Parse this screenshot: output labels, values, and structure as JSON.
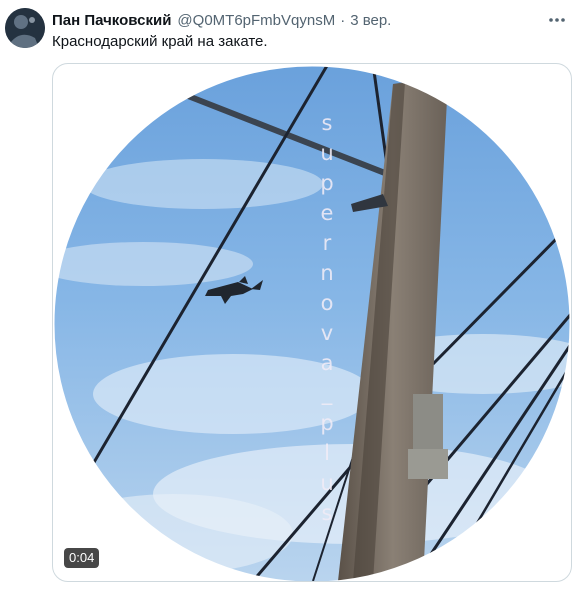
{
  "tweet": {
    "author_name": "Пан Пачковский",
    "handle": "@Q0MT6pFmbVqynsM",
    "separator": "·",
    "time": "3 вер.",
    "text": "Краснодарский край на закате.",
    "media": {
      "watermark": [
        "s",
        "u",
        "p",
        "e",
        "r",
        "n",
        "o",
        "v",
        "a",
        "_",
        "p",
        "l",
        "u",
        "s"
      ],
      "duration": "0:04"
    }
  },
  "icons": {
    "more": "more-horizontal-icon",
    "avatar": "avatar-image"
  },
  "colors": {
    "name": "#0f1419",
    "meta": "#536471",
    "border": "#cfd9de",
    "sky": "#7fb0e3"
  }
}
